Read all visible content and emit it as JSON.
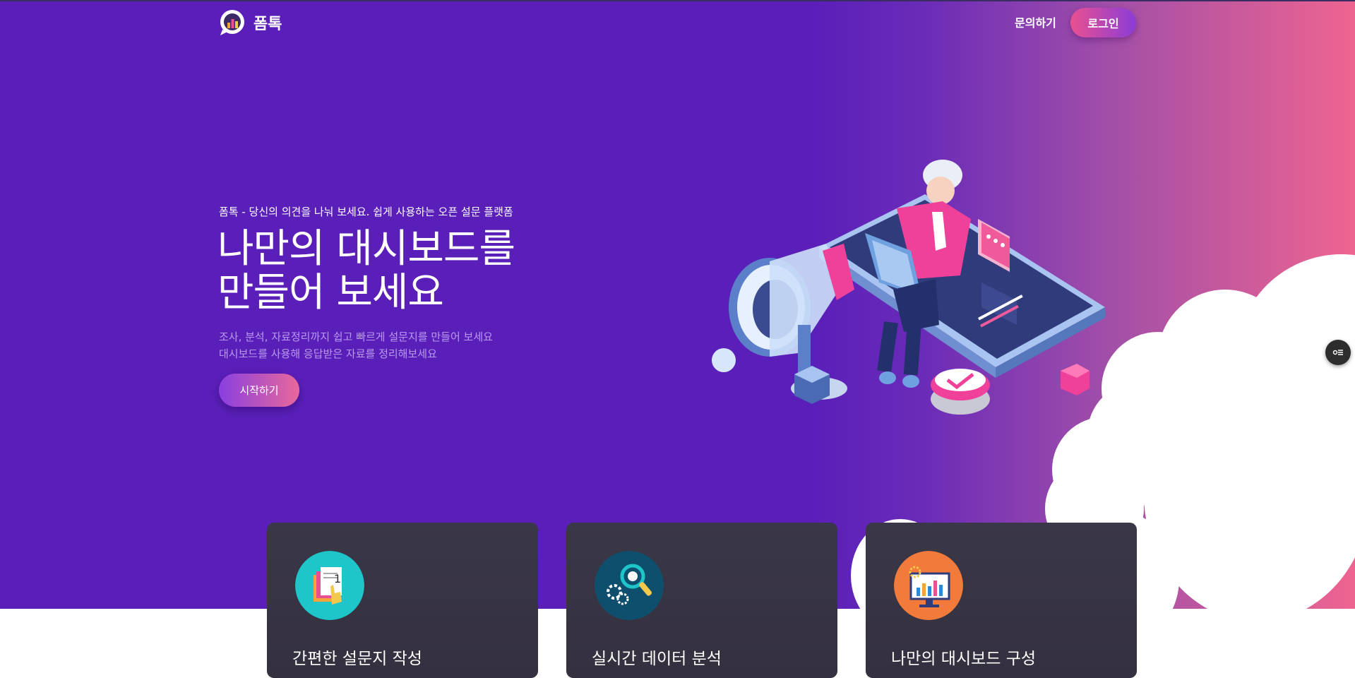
{
  "nav": {
    "brand": "폼톡",
    "contact_link": "문의하기",
    "login_button": "로그인"
  },
  "hero": {
    "tagline": "폼톡 - 당신의 의견을 나눠 보세요. 쉽게 사용하는 오픈 설문 플랫폼",
    "headline_line1": "나만의 대시보드를",
    "headline_line2": "만들어 보세요",
    "sub_line1": "조사, 분석, 자료정리까지 쉽고 빠르게 설문지를 만들어 보세요",
    "sub_line2": "대시보드를 사용해 응답받은 자료를 정리해보세요",
    "start_button": "시작하기"
  },
  "features": [
    {
      "icon": "document-hand-icon",
      "title": "간편한 설문지 작성"
    },
    {
      "icon": "gear-magnifier-icon",
      "title": "실시간 데이터 분석"
    },
    {
      "icon": "monitor-chart-icon",
      "title": "나만의 대시보드 구성"
    }
  ],
  "colors": {
    "hero_purple": "#5a1fb9",
    "hero_pink": "#ee6490",
    "card_dark": "#3a3748",
    "accent_pink": "#e9508f"
  }
}
